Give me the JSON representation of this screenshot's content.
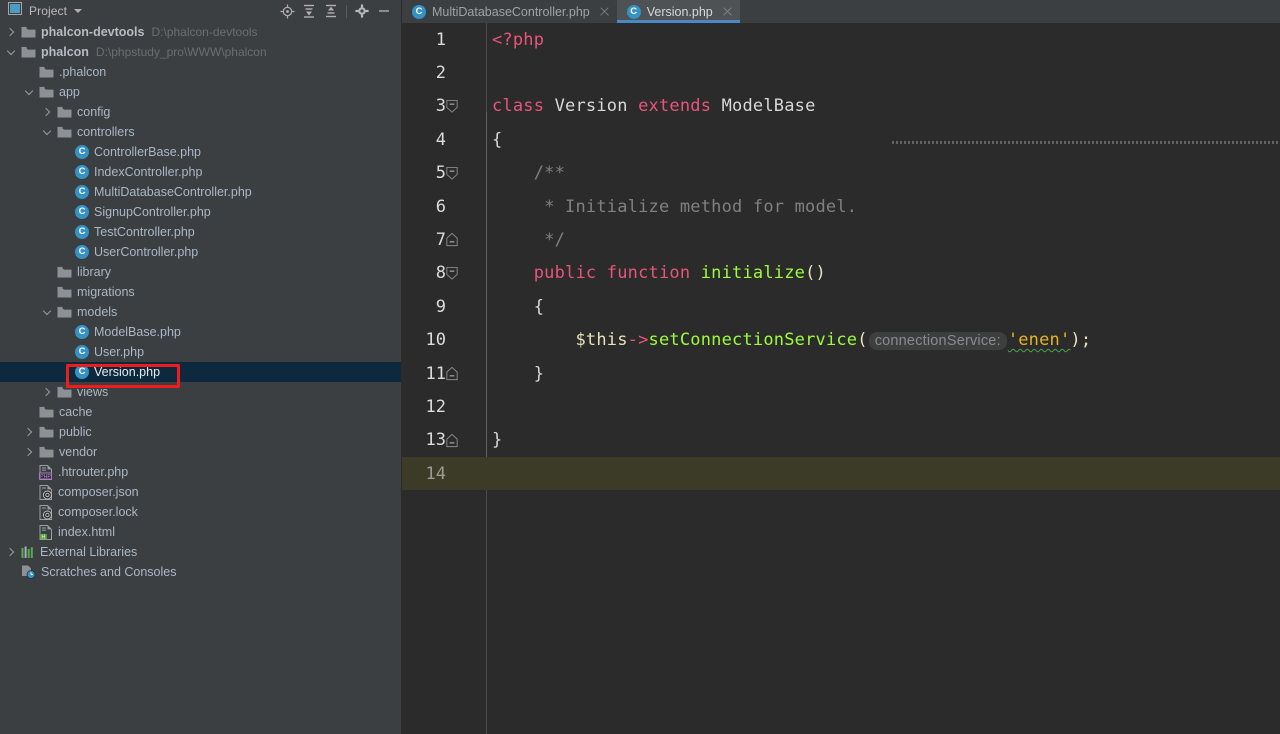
{
  "window": {
    "app": "PhpStorm IDE"
  },
  "toolwindow": {
    "title": "Project",
    "icons": [
      {
        "name": "locate-icon",
        "glyph": "locate"
      },
      {
        "name": "expand-all-icon",
        "glyph": "expand-all"
      },
      {
        "name": "collapse-all-icon",
        "glyph": "collapse-all"
      },
      {
        "name": "gear-icon",
        "glyph": "gear"
      },
      {
        "name": "minimize-icon",
        "glyph": "minimize"
      }
    ]
  },
  "tree": {
    "items": [
      {
        "label": "phalcon-devtools",
        "path": "D:\\phalcon-devtools",
        "indent": 0,
        "arrow": "right",
        "icon": "folder",
        "bold": true,
        "selected": false
      },
      {
        "label": "phalcon",
        "path": "D:\\phpstudy_pro\\WWW\\phalcon",
        "indent": 0,
        "arrow": "down",
        "icon": "folder",
        "bold": true,
        "selected": false
      },
      {
        "label": ".phalcon",
        "path": "",
        "indent": 1,
        "arrow": "none",
        "icon": "folder",
        "bold": false,
        "selected": false
      },
      {
        "label": "app",
        "path": "",
        "indent": 1,
        "arrow": "down",
        "icon": "folder",
        "bold": false,
        "selected": false
      },
      {
        "label": "config",
        "path": "",
        "indent": 2,
        "arrow": "right",
        "icon": "folder",
        "bold": false,
        "selected": false
      },
      {
        "label": "controllers",
        "path": "",
        "indent": 2,
        "arrow": "down",
        "icon": "folder",
        "bold": false,
        "selected": false
      },
      {
        "label": "ControllerBase.php",
        "path": "",
        "indent": 3,
        "arrow": "none",
        "icon": "class",
        "bold": false,
        "selected": false
      },
      {
        "label": "IndexController.php",
        "path": "",
        "indent": 3,
        "arrow": "none",
        "icon": "class",
        "bold": false,
        "selected": false
      },
      {
        "label": "MultiDatabaseController.php",
        "path": "",
        "indent": 3,
        "arrow": "none",
        "icon": "class",
        "bold": false,
        "selected": false
      },
      {
        "label": "SignupController.php",
        "path": "",
        "indent": 3,
        "arrow": "none",
        "icon": "class",
        "bold": false,
        "selected": false
      },
      {
        "label": "TestController.php",
        "path": "",
        "indent": 3,
        "arrow": "none",
        "icon": "class",
        "bold": false,
        "selected": false
      },
      {
        "label": "UserController.php",
        "path": "",
        "indent": 3,
        "arrow": "none",
        "icon": "class",
        "bold": false,
        "selected": false
      },
      {
        "label": "library",
        "path": "",
        "indent": 2,
        "arrow": "none",
        "icon": "folder",
        "bold": false,
        "selected": false
      },
      {
        "label": "migrations",
        "path": "",
        "indent": 2,
        "arrow": "none",
        "icon": "folder",
        "bold": false,
        "selected": false
      },
      {
        "label": "models",
        "path": "",
        "indent": 2,
        "arrow": "down",
        "icon": "folder",
        "bold": false,
        "selected": false
      },
      {
        "label": "ModelBase.php",
        "path": "",
        "indent": 3,
        "arrow": "none",
        "icon": "class",
        "bold": false,
        "selected": false
      },
      {
        "label": "User.php",
        "path": "",
        "indent": 3,
        "arrow": "none",
        "icon": "class",
        "bold": false,
        "selected": false
      },
      {
        "label": "Version.php",
        "path": "",
        "indent": 3,
        "arrow": "none",
        "icon": "class",
        "bold": false,
        "selected": true
      },
      {
        "label": "views",
        "path": "",
        "indent": 2,
        "arrow": "right",
        "icon": "folder",
        "bold": false,
        "selected": false
      },
      {
        "label": "cache",
        "path": "",
        "indent": 1,
        "arrow": "none",
        "icon": "folder",
        "bold": false,
        "selected": false
      },
      {
        "label": "public",
        "path": "",
        "indent": 1,
        "arrow": "right",
        "icon": "folder",
        "bold": false,
        "selected": false
      },
      {
        "label": "vendor",
        "path": "",
        "indent": 1,
        "arrow": "right",
        "icon": "folder",
        "bold": false,
        "selected": false
      },
      {
        "label": ".htrouter.php",
        "path": "",
        "indent": 1,
        "arrow": "none",
        "icon": "php-file",
        "bold": false,
        "selected": false
      },
      {
        "label": "composer.json",
        "path": "",
        "indent": 1,
        "arrow": "none",
        "icon": "composer-file",
        "bold": false,
        "selected": false
      },
      {
        "label": "composer.lock",
        "path": "",
        "indent": 1,
        "arrow": "none",
        "icon": "composer-file",
        "bold": false,
        "selected": false
      },
      {
        "label": "index.html",
        "path": "",
        "indent": 1,
        "arrow": "none",
        "icon": "html-file",
        "bold": false,
        "selected": false
      },
      {
        "label": "External Libraries",
        "path": "",
        "indent": 0,
        "arrow": "right",
        "icon": "libraries",
        "bold": false,
        "selected": false
      },
      {
        "label": "Scratches and Consoles",
        "path": "",
        "indent": 0,
        "arrow": "none",
        "icon": "scratches",
        "bold": false,
        "selected": false
      }
    ]
  },
  "annotation": {
    "name": "red-highlight-box",
    "color": "#f01c1c",
    "target": "Version.php"
  },
  "tabs": [
    {
      "label": "MultiDatabaseController.php",
      "icon": "class",
      "active": false
    },
    {
      "label": "Version.php",
      "icon": "class",
      "active": true
    }
  ],
  "editor": {
    "active_file": "Version.php",
    "current_line": 14,
    "accent": "#4a88c7",
    "lines": [
      {
        "num": "1",
        "fold": "none",
        "current": false
      },
      {
        "num": "2",
        "fold": "none",
        "current": false
      },
      {
        "num": "3",
        "fold": "open",
        "current": false
      },
      {
        "num": "4",
        "fold": "none",
        "current": false
      },
      {
        "num": "5",
        "fold": "open",
        "current": false
      },
      {
        "num": "6",
        "fold": "none",
        "current": false
      },
      {
        "num": "7",
        "fold": "end",
        "current": false
      },
      {
        "num": "8",
        "fold": "open",
        "current": false
      },
      {
        "num": "9",
        "fold": "none",
        "current": false
      },
      {
        "num": "10",
        "fold": "none",
        "current": false
      },
      {
        "num": "11",
        "fold": "end",
        "current": false
      },
      {
        "num": "12",
        "fold": "none",
        "current": false
      },
      {
        "num": "13",
        "fold": "end",
        "current": false
      },
      {
        "num": "14",
        "fold": "none",
        "current": true
      }
    ],
    "source": {
      "l1": "<?php",
      "l2": "",
      "l3_kw": "class",
      "l3_name": "Version",
      "l3_ext": "extends",
      "l3_parent": "ModelBase",
      "l4": "{",
      "l5": "/**",
      "l6": "* Initialize method for model.",
      "l7": "*/",
      "l8_mod": "public",
      "l8_fn_kw": "function",
      "l8_name": "initialize",
      "l8_parens": "()",
      "l9": "{",
      "l10_var": "$this",
      "l10_arrow": "->",
      "l10_method": "setConnectionService",
      "l10_open": "(",
      "l10_hint": "connectionService:",
      "l10_str": "'enen'",
      "l10_close": ");",
      "l11": "}",
      "l12": "",
      "l13": "}",
      "l14": ""
    }
  }
}
